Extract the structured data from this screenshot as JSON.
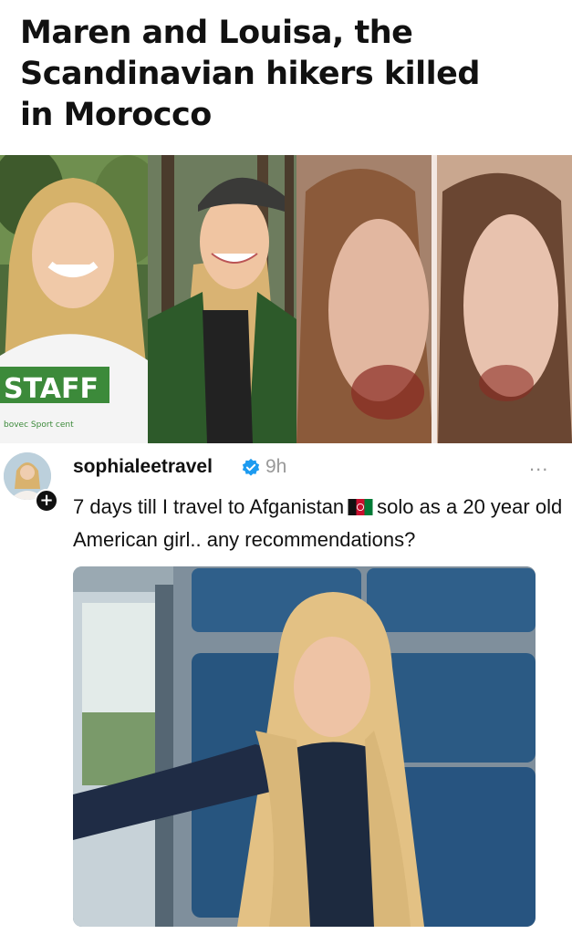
{
  "headline": {
    "line1": "Maren and Louisa, the",
    "line2": "Scandinavian hikers killed",
    "line3": "in Morocco"
  },
  "photos": {
    "shirt_text": "STAFF",
    "shirt_subtext": "bovec Sport cent"
  },
  "post": {
    "username": "sophialeetravel",
    "time": "9h",
    "more_label": "...",
    "text_part1": "7 days till I travel to Afganistan",
    "text_part2": "solo as a 20 year old American girl.. any recommendations?",
    "flag_icon": "afghanistan-flag-icon",
    "verified_icon": "verified-badge-icon",
    "verified_color": "#1d9bf0"
  }
}
